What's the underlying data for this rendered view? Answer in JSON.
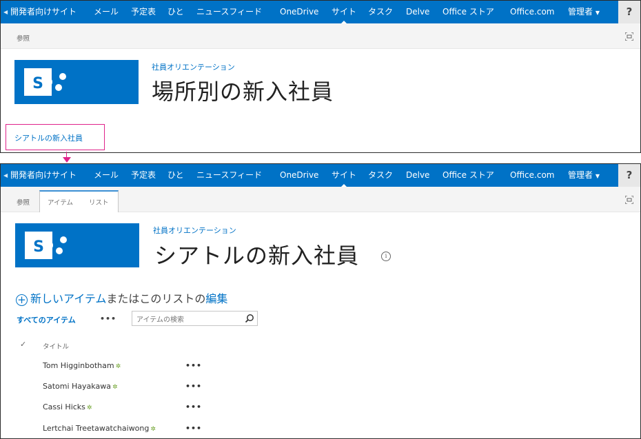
{
  "suite_nav": {
    "items": [
      "開発者向けサイト",
      "メール",
      "予定表",
      "ひと",
      "ニュースフィード",
      "OneDrive",
      "サイト",
      "タスク",
      "Delve",
      "Office ストア",
      "Office.com"
    ],
    "admin": "管理者",
    "help": "?"
  },
  "frame1": {
    "ribbon_tab": "参照",
    "site_link": "社員オリエンテーション",
    "title": "場所別の新入社員",
    "callout_link": "シアトルの新入社員"
  },
  "frame2": {
    "ribbon_tabs": [
      "参照",
      "アイテム",
      "リスト"
    ],
    "site_link": "社員オリエンテーション",
    "title": "シアトルの新入社員",
    "new_item": {
      "link": "新しいアイテム",
      "middle": "またはこのリストの",
      "edit": "編集"
    },
    "view_all": "すべてのアイテム",
    "search_placeholder": "アイテムの検索",
    "column_title": "タイトル",
    "rows": [
      "Tom Higginbotham",
      "Satomi Hayakawa",
      "Cassi Hicks",
      "Lertchai Treetawatchaiwong"
    ]
  },
  "colors": {
    "suite_bar": "#0072c6",
    "callout": "#e0228a",
    "new_badge": "#6ca12a"
  }
}
